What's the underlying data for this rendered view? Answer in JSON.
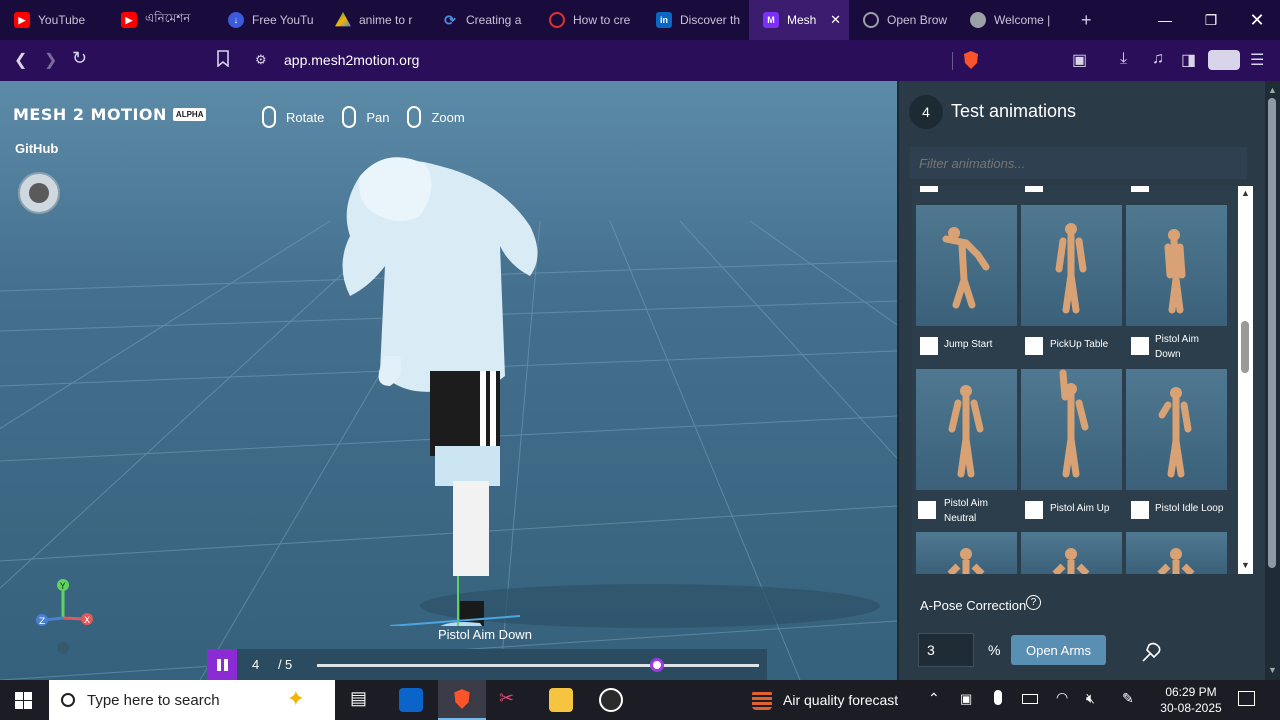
{
  "browser": {
    "tabs": [
      {
        "label": "YouTube",
        "icon": "youtube-icon",
        "color": "#ff0000"
      },
      {
        "label": "এনিমেশন",
        "icon": "youtube-icon",
        "color": "#ff0000"
      },
      {
        "label": "Free YouTu",
        "icon": "download-icon",
        "color": "#3b5bdb"
      },
      {
        "label": "anime to r",
        "icon": "drive-icon",
        "color": "#f4b400"
      },
      {
        "label": "Creating a",
        "icon": "link-icon",
        "color": "#4a90d9"
      },
      {
        "label": "How to cre",
        "icon": "search-icon",
        "color": "#e03131"
      },
      {
        "label": "Discover th",
        "icon": "linkedin-icon",
        "color": "#0a66c2"
      },
      {
        "label": "Mesh",
        "icon": "mesh-icon",
        "color": "#7b2ff7",
        "active": true
      },
      {
        "label": "Open Brow",
        "icon": "globe-icon",
        "color": "#9aa0a6"
      },
      {
        "label": "Welcome |",
        "icon": "globe-icon",
        "color": "#9aa0a6"
      }
    ],
    "url": "app.mesh2motion.org"
  },
  "app": {
    "logo_text": "MESH 2 MOTION",
    "logo_badge": "ALPHA",
    "github": "GitHub",
    "controls": [
      {
        "label": "Rotate"
      },
      {
        "label": "Pan"
      },
      {
        "label": "Zoom"
      }
    ],
    "current_animation": "Pistol Aim Down",
    "playback": {
      "current": "4",
      "sep": "/",
      "total": "5",
      "progress": 0.77
    }
  },
  "panel": {
    "step": "4",
    "title": "Test animations",
    "filter_placeholder": "Filter animations...",
    "row1": [
      {
        "label": "Jump Start"
      },
      {
        "label": "PickUp Table"
      },
      {
        "label": "Pistol Aim Down"
      }
    ],
    "row2": [
      {
        "label": "Pistol Aim Neutral"
      },
      {
        "label": "Pistol Aim Up"
      },
      {
        "label": "Pistol Idle Loop"
      }
    ],
    "apose_label": "A-Pose Correction",
    "apose_value": "3",
    "apose_unit": "%",
    "open_arms": "Open Arms"
  },
  "taskbar": {
    "search_placeholder": "Type here to search",
    "weather": "Air quality forecast",
    "time": "06:29 PM",
    "date": "30-08-2025"
  }
}
